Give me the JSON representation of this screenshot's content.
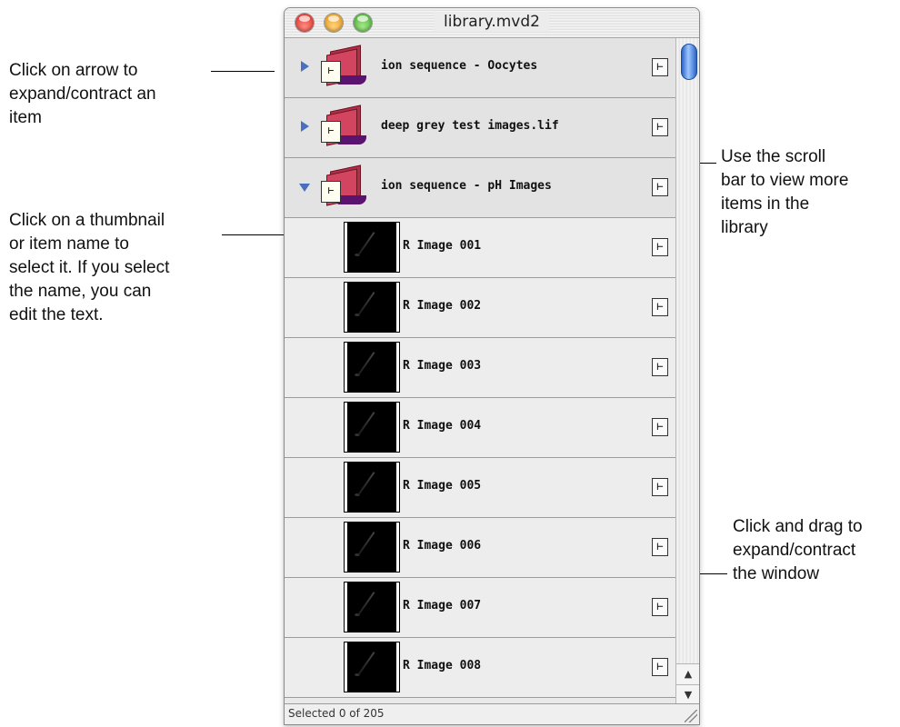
{
  "window": {
    "title": "library.mvd2",
    "status": "Selected 0 of 205"
  },
  "groups": [
    {
      "name": "ion sequence - Oocytes",
      "expanded": false
    },
    {
      "name": "deep grey test images.lif",
      "expanded": false
    },
    {
      "name": "ion sequence - pH Images",
      "expanded": true
    }
  ],
  "items": [
    {
      "name": "R Image 001"
    },
    {
      "name": "R Image 002"
    },
    {
      "name": "R Image 003"
    },
    {
      "name": "R Image 004"
    },
    {
      "name": "R Image 005"
    },
    {
      "name": "R Image 006"
    },
    {
      "name": "R Image 007"
    },
    {
      "name": "R Image 008"
    }
  ],
  "annotations": {
    "arrow": "Click on arrow to\nexpand/contract an\nitem",
    "thumbnail": "Click on a thumbnail\nor item name to\nselect it. If you select\nthe name, you can\nedit the text.",
    "scroll": "Use the scroll\nbar to view more\nitems in the\nlibrary",
    "drag": "Click and drag to\nexpand/contract\nthe window"
  },
  "icons": {
    "tree_glyph": "⊢",
    "scroll_up": "▲",
    "scroll_down": "▼"
  },
  "colors": {
    "disclosure": "#4a6fbf",
    "scroll_thumb": "#2b64c8",
    "folder": "#d2445f"
  }
}
